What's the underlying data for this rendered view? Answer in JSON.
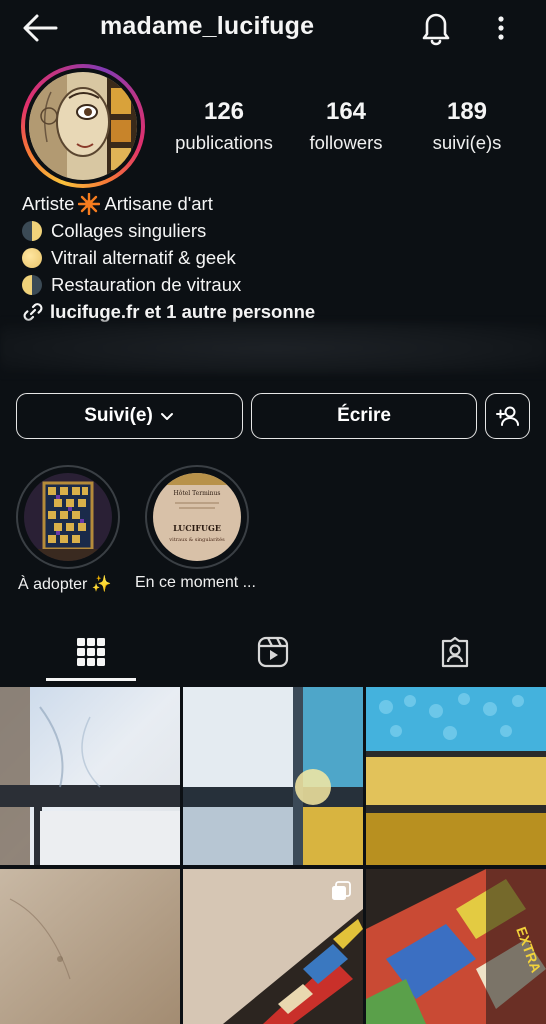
{
  "header": {
    "username": "madame_lucifuge",
    "back_icon": "arrow-left-icon",
    "bell_icon": "bell-icon",
    "more_icon": "more-vertical-icon"
  },
  "stats": [
    {
      "value": "126",
      "label": "publications"
    },
    {
      "value": "164",
      "label": "followers"
    },
    {
      "value": "189",
      "label": "suivi(e)s"
    }
  ],
  "bio": {
    "line1_a": "Artiste",
    "line1_b": "Artisane d'art",
    "line2": "Collages singuliers",
    "line3": "Vitrail alternatif & geek",
    "line4": "Restauration de vitraux",
    "link": "lucifuge.fr et 1 autre personne"
  },
  "actions": {
    "follow_label": "Suivi(e)",
    "message_label": "Écrire",
    "add_icon": "add-person-icon"
  },
  "highlights": [
    {
      "label": "À adopter ✨"
    },
    {
      "label": "En ce moment ..."
    }
  ],
  "highlight_art": {
    "line1": "Hôtel Terminus",
    "line2": "LUCIFUGE",
    "line3": "vitraux & singularités"
  },
  "tabs": [
    {
      "icon": "grid-icon",
      "active": true
    },
    {
      "icon": "reels-icon",
      "active": false
    },
    {
      "icon": "tagged-icon",
      "active": false
    }
  ],
  "colors": {
    "background": "#0c1014",
    "text": "#f5f5f5",
    "story_ring_start": "#f9c23c",
    "story_ring_end": "#c13584"
  }
}
